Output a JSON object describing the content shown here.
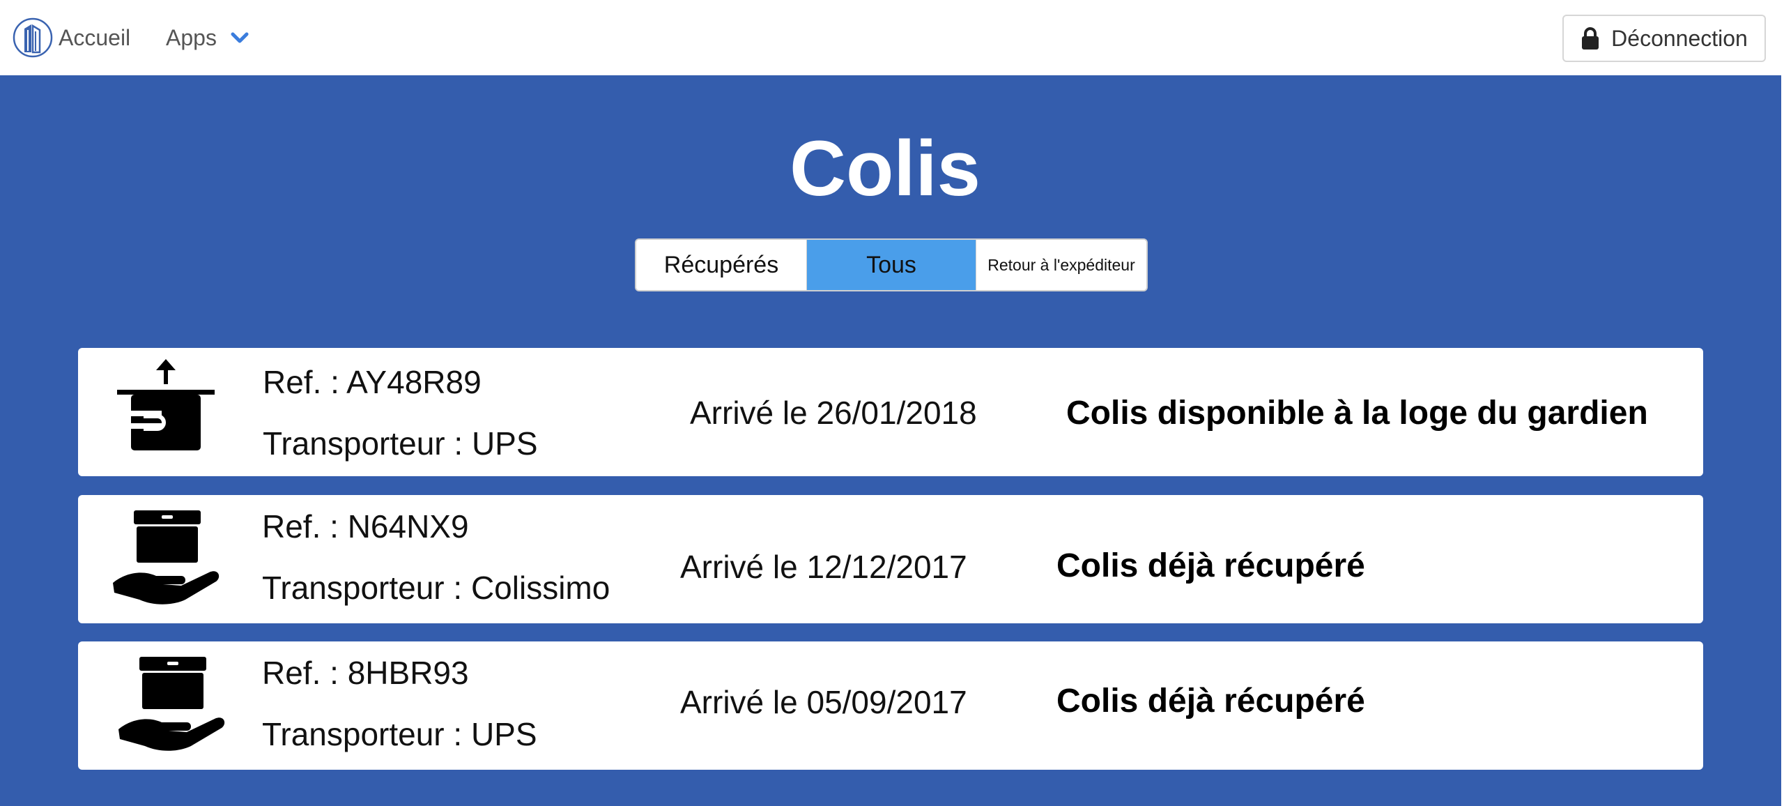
{
  "navbar": {
    "home_label": "Accueil",
    "apps_label": "Apps",
    "logout_label": "Déconnection"
  },
  "page": {
    "title": "Colis"
  },
  "filters": [
    {
      "label": "Récupérés",
      "active": false
    },
    {
      "label": "Tous",
      "active": true
    },
    {
      "label": "Retour à l'expéditeur",
      "active": false
    }
  ],
  "parcels": [
    {
      "icon": "box-upload-icon",
      "ref": "Ref. : AY48R89",
      "carrier": "Transporteur : UPS",
      "arrival": "Arrivé le 26/01/2018",
      "status": "Colis disponible à la loge du gardien"
    },
    {
      "icon": "hand-holding-box-icon",
      "ref": "Ref. : N64NX9",
      "carrier": "Transporteur : Colissimo",
      "arrival": "Arrivé le 12/12/2017",
      "status": "Colis déjà récupéré"
    },
    {
      "icon": "hand-holding-box-icon",
      "ref": "Ref. : 8HBR93",
      "carrier": "Transporteur : UPS",
      "arrival": "Arrivé le 05/09/2017",
      "status": "Colis déjà récupéré"
    }
  ],
  "colors": {
    "main_background": "#345dad",
    "active_filter": "#4a9eea",
    "accent_chevron": "#3b7ddd"
  }
}
